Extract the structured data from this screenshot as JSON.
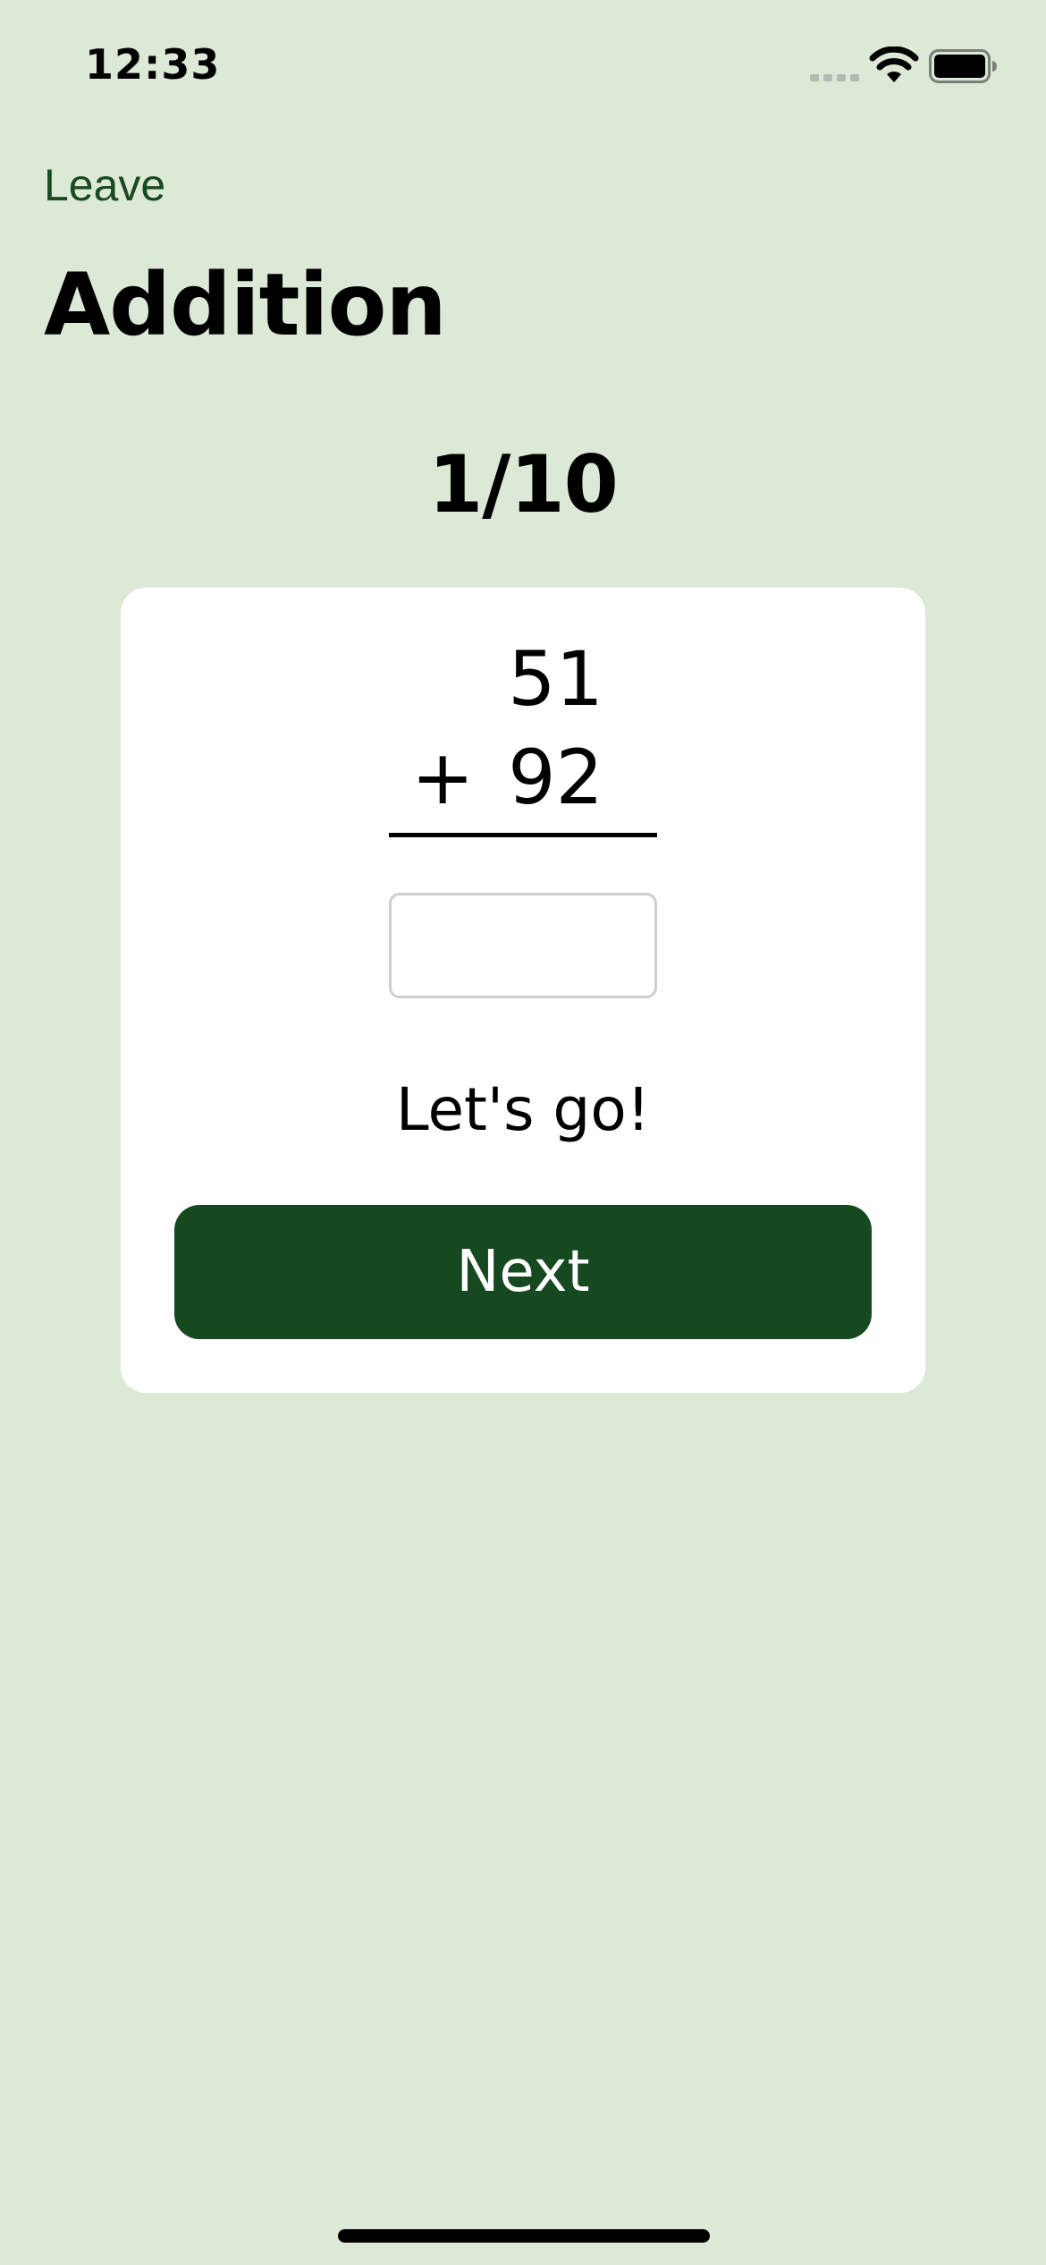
{
  "status_bar": {
    "time": "12:33",
    "icons": [
      "signal-icon",
      "wifi-icon",
      "battery-icon"
    ]
  },
  "nav": {
    "back_label": "Leave"
  },
  "page": {
    "title": "Addition"
  },
  "progress": {
    "label": "1/10",
    "current": 1,
    "total": 10
  },
  "question": {
    "operand_top": "51",
    "operator": "+",
    "operand_bottom": "92",
    "answer_value": "",
    "answer_placeholder": ""
  },
  "feedback": {
    "message": "Let's go!"
  },
  "actions": {
    "next_label": "Next"
  },
  "colors": {
    "background": "#dce9d6",
    "accent": "#16491f",
    "card": "#ffffff",
    "link": "#1a4a1f"
  }
}
